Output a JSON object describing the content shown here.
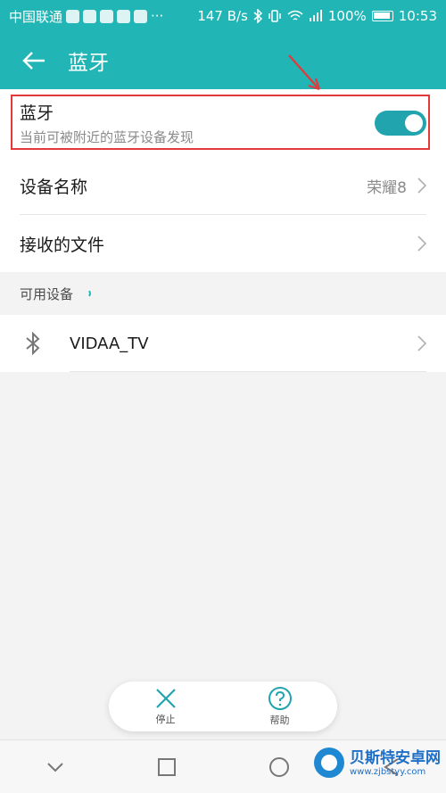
{
  "status_bar": {
    "carrier": "中国联通",
    "more": "···",
    "speed": "147 B/s",
    "battery": "100%",
    "time": "10:53"
  },
  "app_bar": {
    "title": "蓝牙"
  },
  "bluetooth": {
    "title": "蓝牙",
    "subtitle": "当前可被附近的蓝牙设备发现",
    "enabled": true
  },
  "device_name": {
    "label": "设备名称",
    "value": "荣耀8"
  },
  "received_files": {
    "label": "接收的文件"
  },
  "available_devices": {
    "header": "可用设备",
    "items": [
      {
        "name": "VIDAA_TV"
      }
    ]
  },
  "actions": {
    "stop_label": "停止",
    "help_label": "帮助"
  },
  "watermark": {
    "name": "贝斯特安卓网",
    "url": "www.zjbstyy.com"
  },
  "colors": {
    "accent": "#21b5b5",
    "highlight": "#e23a3a"
  }
}
